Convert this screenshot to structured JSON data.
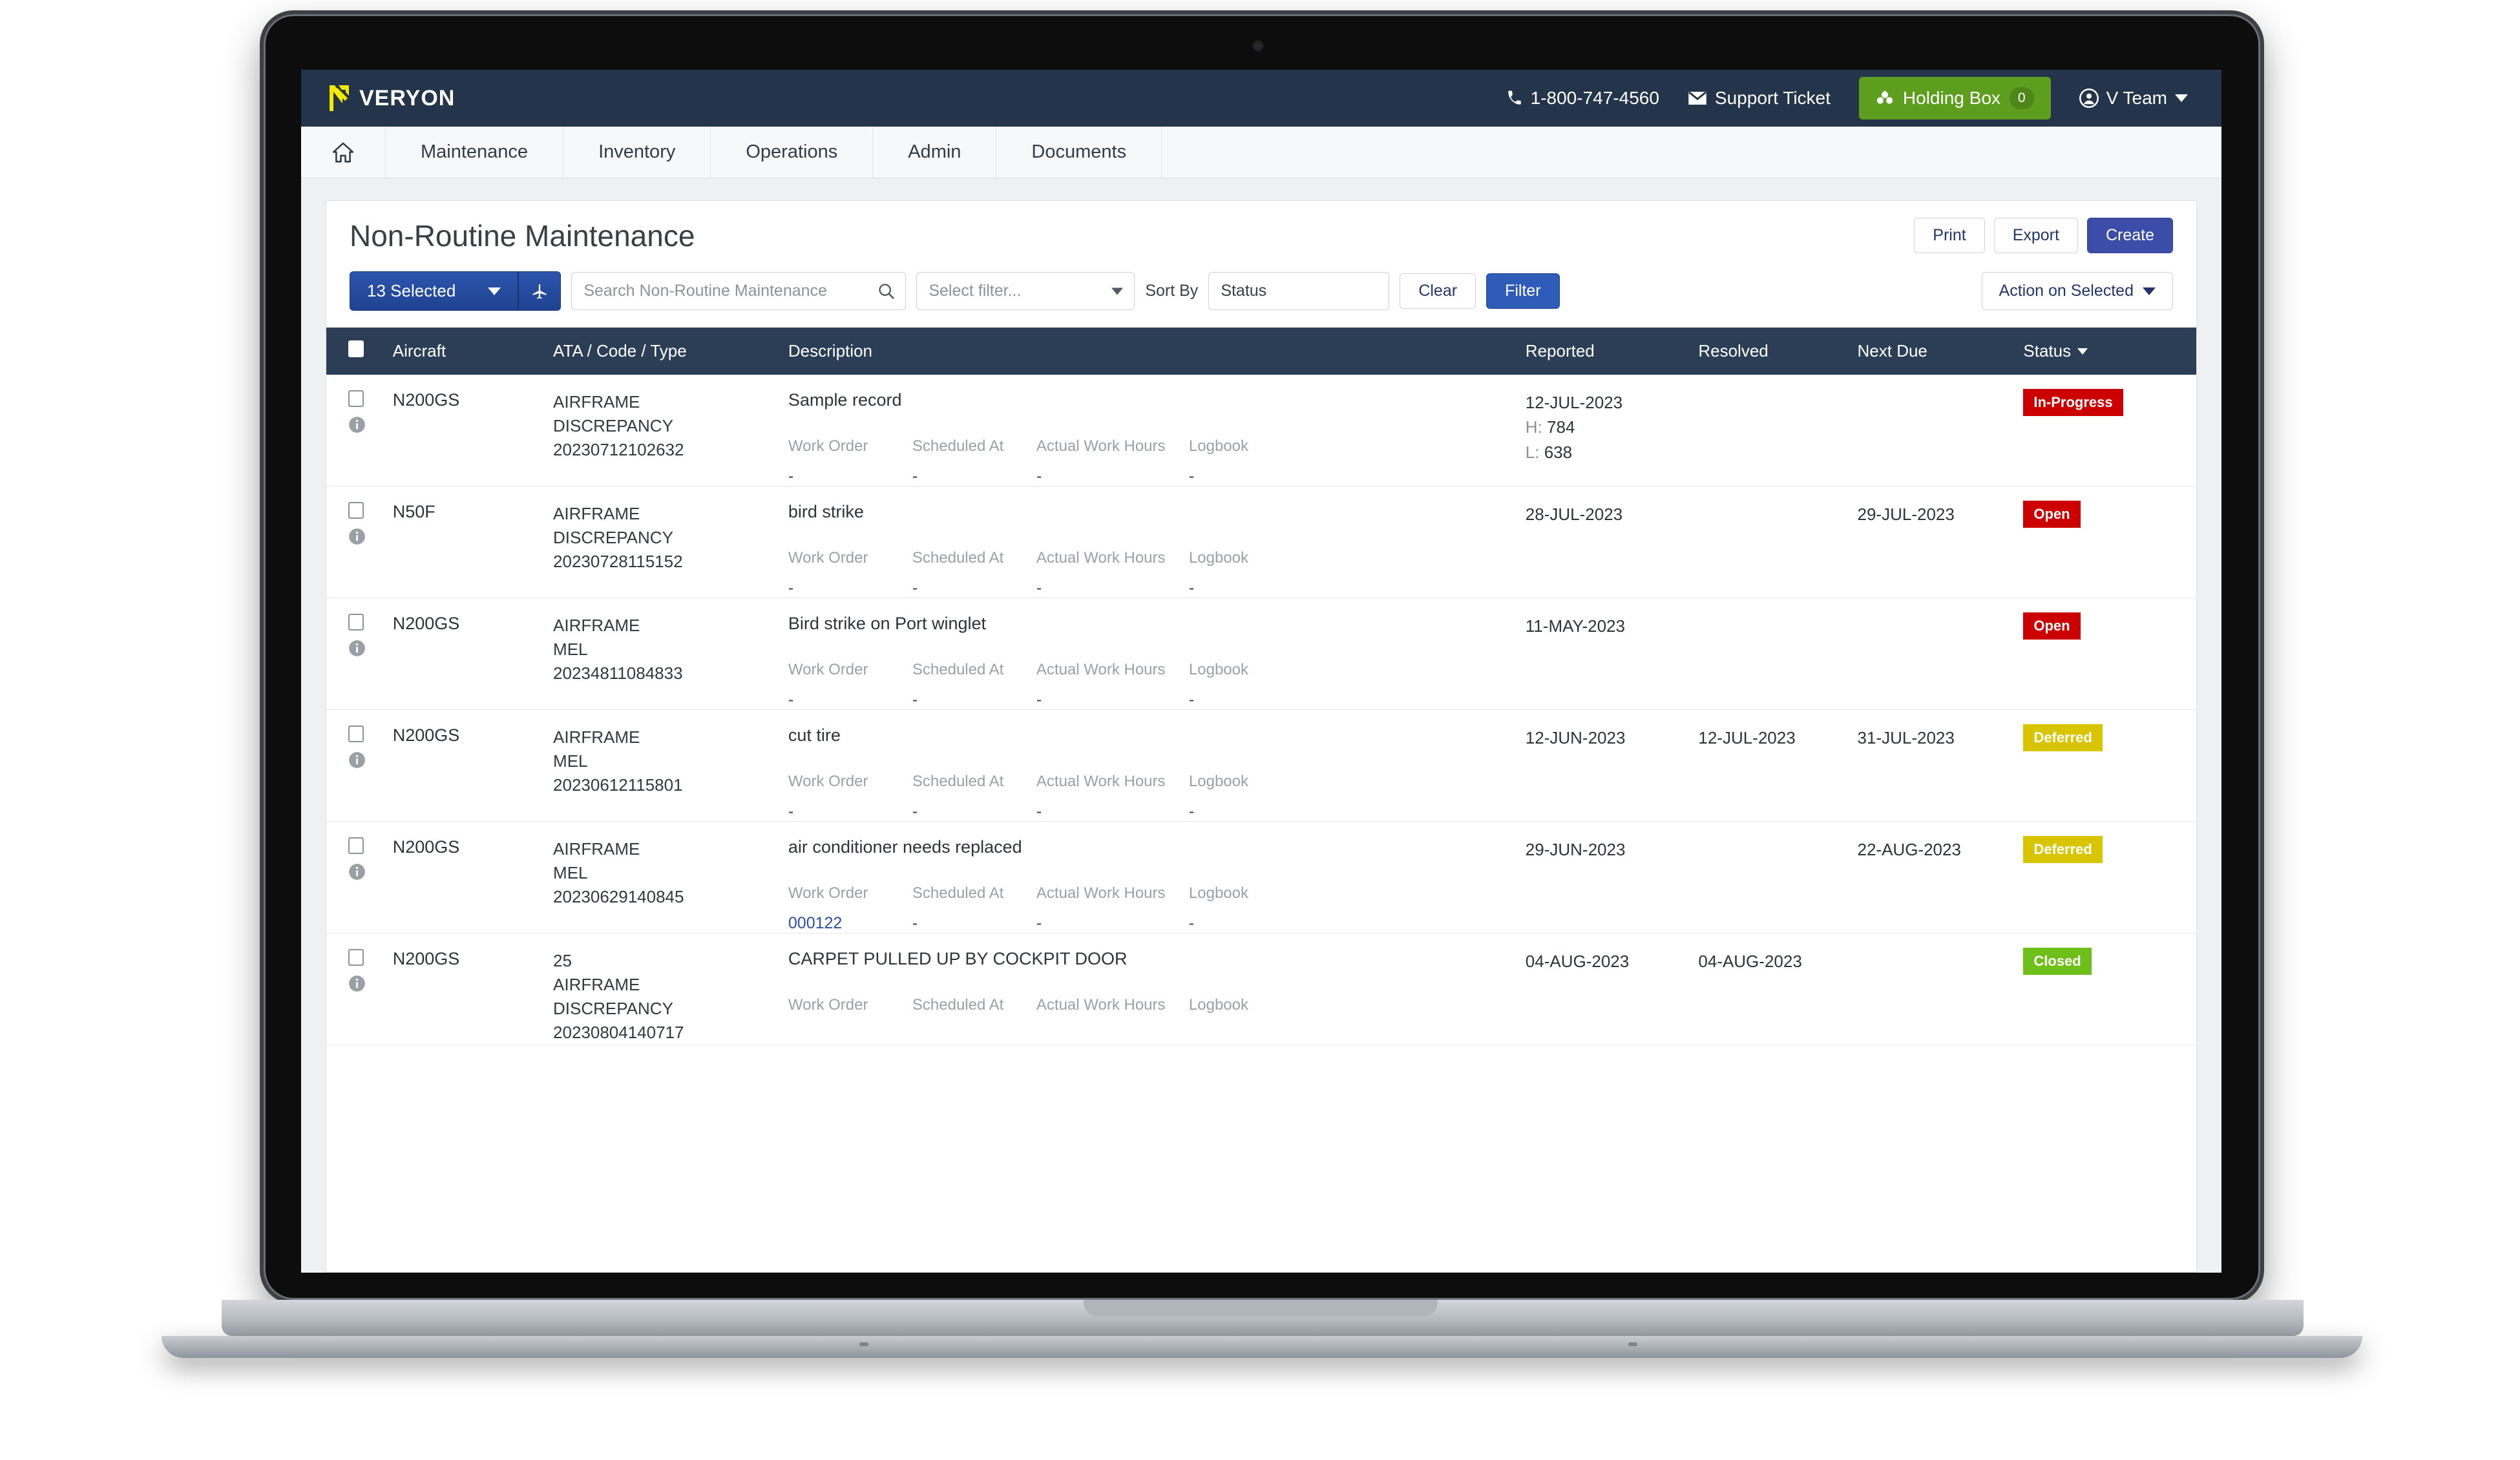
{
  "topbar": {
    "logo_text": "VERYON",
    "phone": "1-800-747-4560",
    "support_ticket": "Support Ticket",
    "holding_box": "Holding Box",
    "holding_box_count": "0",
    "user": "V Team"
  },
  "nav": {
    "items": [
      {
        "label": "Maintenance"
      },
      {
        "label": "Inventory"
      },
      {
        "label": "Operations"
      },
      {
        "label": "Admin"
      },
      {
        "label": "Documents"
      }
    ]
  },
  "page": {
    "title": "Non-Routine Maintenance",
    "print": "Print",
    "export": "Export",
    "create": "Create"
  },
  "toolbar": {
    "selected_label": "13 Selected",
    "search_placeholder": "Search Non-Routine Maintenance",
    "filter_select": "Select filter...",
    "sort_by_label": "Sort By",
    "sort_by_value": "Status",
    "clear": "Clear",
    "filter": "Filter",
    "action_on_selected": "Action on Selected"
  },
  "table": {
    "headers": {
      "aircraft": "Aircraft",
      "ata": "ATA / Code / Type",
      "description": "Description",
      "reported": "Reported",
      "resolved": "Resolved",
      "next_due": "Next Due",
      "status": "Status"
    },
    "sub_labels": {
      "work_order": "Work Order",
      "scheduled_at": "Scheduled At",
      "actual_work_hours": "Actual Work Hours",
      "logbook": "Logbook"
    },
    "rows": [
      {
        "aircraft": "N200GS",
        "ata": "",
        "code": "AIRFRAME",
        "type": "DISCREPANCY",
        "number": "20230712102632",
        "description": "Sample record",
        "work_order": "-",
        "scheduled_at": "-",
        "actual_work_hours": "-",
        "logbook": "-",
        "reported": "12-JUL-2023",
        "reported_hours": "H: 784",
        "reported_landings": "L: 638",
        "resolved": "",
        "next_due": "",
        "status": "In-Progress",
        "status_color": "red"
      },
      {
        "aircraft": "N50F",
        "ata": "",
        "code": "AIRFRAME",
        "type": "DISCREPANCY",
        "number": "20230728115152",
        "description": "bird strike",
        "work_order": "-",
        "scheduled_at": "-",
        "actual_work_hours": "-",
        "logbook": "-",
        "reported": "28-JUL-2023",
        "reported_hours": "",
        "reported_landings": "",
        "resolved": "",
        "next_due": "29-JUL-2023",
        "status": "Open",
        "status_color": "red"
      },
      {
        "aircraft": "N200GS",
        "ata": "",
        "code": "AIRFRAME",
        "type": "MEL",
        "number": "20234811084833",
        "description": "Bird strike on Port winglet",
        "work_order": "-",
        "scheduled_at": "-",
        "actual_work_hours": "-",
        "logbook": "-",
        "reported": "11-MAY-2023",
        "reported_hours": "",
        "reported_landings": "",
        "resolved": "",
        "next_due": "",
        "status": "Open",
        "status_color": "red"
      },
      {
        "aircraft": "N200GS",
        "ata": "",
        "code": "AIRFRAME",
        "type": "MEL",
        "number": "20230612115801",
        "description": "cut tire",
        "work_order": "-",
        "scheduled_at": "-",
        "actual_work_hours": "-",
        "logbook": "-",
        "reported": "12-JUN-2023",
        "reported_hours": "",
        "reported_landings": "",
        "resolved": "12-JUL-2023",
        "next_due": "31-JUL-2023",
        "status": "Deferred",
        "status_color": "yellow"
      },
      {
        "aircraft": "N200GS",
        "ata": "",
        "code": "AIRFRAME",
        "type": "MEL",
        "number": "20230629140845",
        "description": "air conditioner needs replaced",
        "work_order": "000122",
        "scheduled_at": "-",
        "actual_work_hours": "-",
        "logbook": "-",
        "reported": "29-JUN-2023",
        "reported_hours": "",
        "reported_landings": "",
        "resolved": "",
        "next_due": "22-AUG-2023",
        "status": "Deferred",
        "status_color": "yellow"
      },
      {
        "aircraft": "N200GS",
        "ata": "25",
        "code": "AIRFRAME",
        "type": "DISCREPANCY",
        "number": "20230804140717",
        "description": "CARPET PULLED UP BY COCKPIT DOOR",
        "work_order": "",
        "scheduled_at": "",
        "actual_work_hours": "",
        "logbook": "",
        "reported": "04-AUG-2023",
        "reported_hours": "",
        "reported_landings": "",
        "resolved": "04-AUG-2023",
        "next_due": "",
        "status": "Closed",
        "status_color": "green"
      }
    ]
  },
  "colors": {
    "topbar": "#24344a",
    "brand_yellow": "#f2e900",
    "primary_blue": "#3b4da8",
    "holding_green": "#5e9e1e",
    "status_red": "#cc0000",
    "status_yellow": "#d9c400",
    "status_green": "#6fbf1a"
  }
}
